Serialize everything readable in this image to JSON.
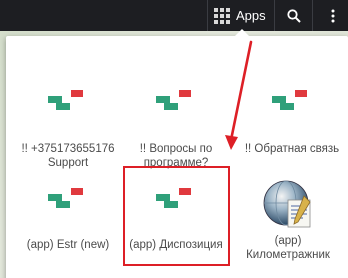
{
  "topbar": {
    "apps_label": "Apps",
    "apps_icon": "app-grid-icon",
    "search_icon": "search-icon",
    "more_icon": "more-vertical-icon"
  },
  "apps": [
    {
      "label": "!! +375173655176 Support",
      "icon": "app-placeholder-icon"
    },
    {
      "label": "!! Вопросы по программе?",
      "icon": "app-placeholder-icon"
    },
    {
      "label": "!! Обратная связь",
      "icon": "app-placeholder-icon"
    },
    {
      "label": "(app) Estr (new)",
      "icon": "app-placeholder-icon"
    },
    {
      "label": "(app) Диспозиция",
      "icon": "app-placeholder-icon"
    },
    {
      "label": "(app) Километражник",
      "icon": "globe-document-icon"
    }
  ],
  "annotation": {
    "highlight_color": "#dd1f26",
    "highlighted_app": "(app) Диспозиция"
  },
  "colors": {
    "topbar": "#1d1e22",
    "tile_green": "#2fa07a",
    "tile_red": "#e0393e"
  }
}
